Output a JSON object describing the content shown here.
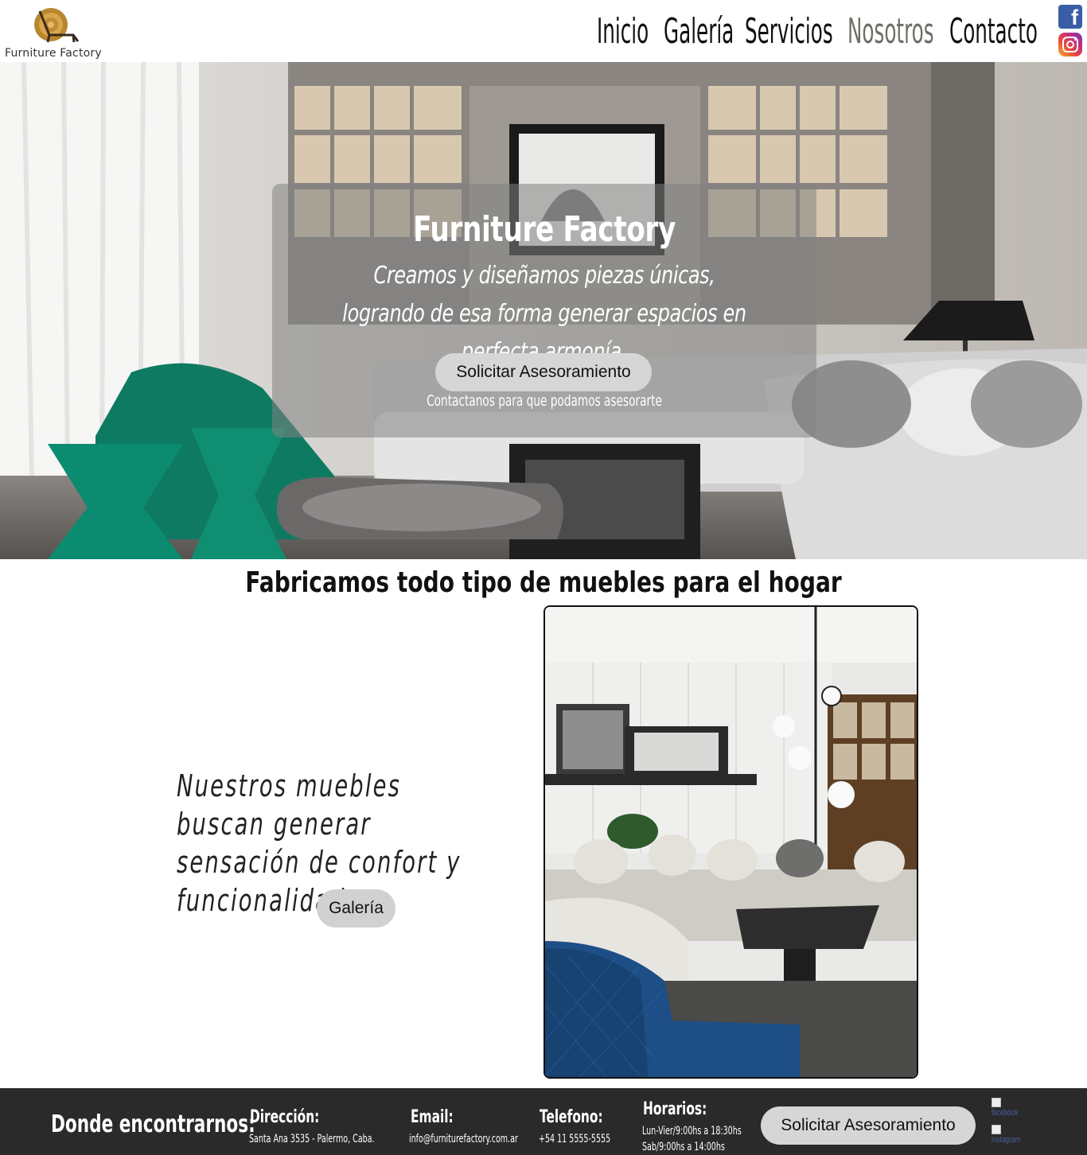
{
  "header": {
    "logo_text": "Furniture Factory",
    "nav": [
      {
        "label": "Inicio",
        "active": false
      },
      {
        "label": "Galería",
        "active": false
      },
      {
        "label": "Servicios",
        "active": false
      },
      {
        "label": "Nosotros",
        "active": true
      },
      {
        "label": "Contacto",
        "active": false
      }
    ],
    "social_icons": [
      "facebook-icon",
      "instagram-icon"
    ]
  },
  "hero": {
    "title": "Furniture Factory",
    "subtitle": "Creamos y diseñamos piezas únicas, logrando de esa forma generar espacios en perfecta armonía.",
    "button_label": "Solicitar Asesoramiento",
    "note": "Contactanos para que podamos asesorarte"
  },
  "section": {
    "title": "Fabricamos todo tipo de muebles para el hogar",
    "text": "Nuestros muebles buscan generar sensación de confort y funcionalidad.",
    "button_label": "Galería"
  },
  "footer": {
    "heading": "Donde encontrarnos:",
    "address_label": "Dirección:",
    "address_value": "Santa Ana 3535 - Palermo, Caba.",
    "email_label": "Email:",
    "email_value": "info@furniturefactory.com.ar",
    "phone_label": "Telefono:",
    "phone_value": "+54 11 5555-5555",
    "hours_label": "Horarios:",
    "hours_weekdays": "Lun-Vier/9:00hs a 18:30hs",
    "hours_saturday": "Sab/9:00hs a 14:00hs",
    "button_label": "Solicitar Asesoramiento",
    "facebook_alt": "facebook",
    "instagram_alt": "instagram"
  },
  "colors": {
    "nav_active": "#6f6f68",
    "footer_bg": "#2a2a2a",
    "button_bg": "#d6d6d6",
    "accent_green": "#0f7a62",
    "accent_blue": "#1d4f86"
  }
}
